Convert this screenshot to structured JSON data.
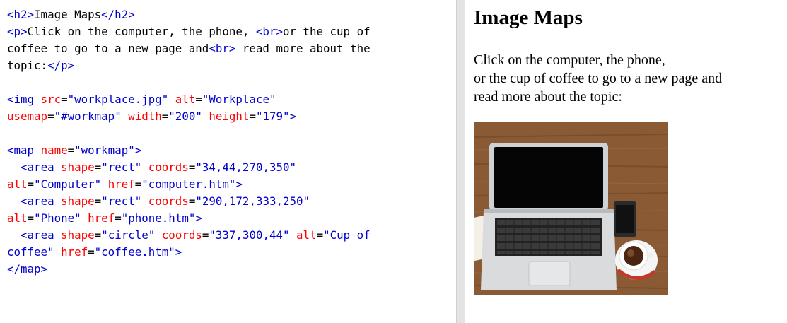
{
  "code_lines": [
    [
      [
        "b",
        "<h2>"
      ],
      [
        "k",
        "Image Maps"
      ],
      [
        "b",
        "</h2>"
      ]
    ],
    [
      [
        "b",
        "<p>"
      ],
      [
        "k",
        "Click on the computer, the phone, "
      ],
      [
        "b",
        "<br>"
      ],
      [
        "k",
        "or the cup of"
      ]
    ],
    [
      [
        "k",
        "coffee to go to a new page and"
      ],
      [
        "b",
        "<br>"
      ],
      [
        "k",
        " read more about the"
      ]
    ],
    [
      [
        "k",
        "topic:"
      ],
      [
        "b",
        "</p>"
      ]
    ],
    [],
    [
      [
        "b",
        "<img "
      ],
      [
        "r",
        "src"
      ],
      [
        "k",
        "="
      ],
      [
        "b",
        "\"workplace.jpg\" "
      ],
      [
        "r",
        "alt"
      ],
      [
        "k",
        "="
      ],
      [
        "b",
        "\"Workplace\""
      ]
    ],
    [
      [
        "r",
        "usemap"
      ],
      [
        "k",
        "="
      ],
      [
        "b",
        "\"#workmap\" "
      ],
      [
        "r",
        "width"
      ],
      [
        "k",
        "="
      ],
      [
        "b",
        "\"200\" "
      ],
      [
        "r",
        "height"
      ],
      [
        "k",
        "="
      ],
      [
        "b",
        "\"179\">"
      ]
    ],
    [],
    [
      [
        "b",
        "<map "
      ],
      [
        "r",
        "name"
      ],
      [
        "k",
        "="
      ],
      [
        "b",
        "\"workmap\">"
      ]
    ],
    [
      [
        "k",
        "  "
      ],
      [
        "b",
        "<area "
      ],
      [
        "r",
        "shape"
      ],
      [
        "k",
        "="
      ],
      [
        "b",
        "\"rect\" "
      ],
      [
        "r",
        "coords"
      ],
      [
        "k",
        "="
      ],
      [
        "b",
        "\"34,44,270,350\""
      ]
    ],
    [
      [
        "r",
        "alt"
      ],
      [
        "k",
        "="
      ],
      [
        "b",
        "\"Computer\" "
      ],
      [
        "r",
        "href"
      ],
      [
        "k",
        "="
      ],
      [
        "b",
        "\"computer.htm\">"
      ]
    ],
    [
      [
        "k",
        "  "
      ],
      [
        "b",
        "<area "
      ],
      [
        "r",
        "shape"
      ],
      [
        "k",
        "="
      ],
      [
        "b",
        "\"rect\" "
      ],
      [
        "r",
        "coords"
      ],
      [
        "k",
        "="
      ],
      [
        "b",
        "\"290,172,333,250\""
      ]
    ],
    [
      [
        "r",
        "alt"
      ],
      [
        "k",
        "="
      ],
      [
        "b",
        "\"Phone\" "
      ],
      [
        "r",
        "href"
      ],
      [
        "k",
        "="
      ],
      [
        "b",
        "\"phone.htm\">"
      ]
    ],
    [
      [
        "k",
        "  "
      ],
      [
        "b",
        "<area "
      ],
      [
        "r",
        "shape"
      ],
      [
        "k",
        "="
      ],
      [
        "b",
        "\"circle\" "
      ],
      [
        "r",
        "coords"
      ],
      [
        "k",
        "="
      ],
      [
        "b",
        "\"337,300,44\" "
      ],
      [
        "r",
        "alt"
      ],
      [
        "k",
        "="
      ],
      [
        "b",
        "\"Cup of"
      ]
    ],
    [
      [
        "b",
        "coffee\" "
      ],
      [
        "r",
        "href"
      ],
      [
        "k",
        "="
      ],
      [
        "b",
        "\"coffee.htm\">"
      ]
    ],
    [
      [
        "b",
        "</map>"
      ]
    ]
  ],
  "result": {
    "heading": "Image Maps",
    "para_line1": "Click on the computer, the phone,",
    "para_line2": "or the cup of coffee to go to a new page and",
    "para_line3": "read more about the topic:"
  },
  "colors": {
    "tag_blue": "#0000cd",
    "attr_red": "#ff0000",
    "wood": "#8a5a34"
  },
  "image": {
    "name": "workplace-photo"
  }
}
